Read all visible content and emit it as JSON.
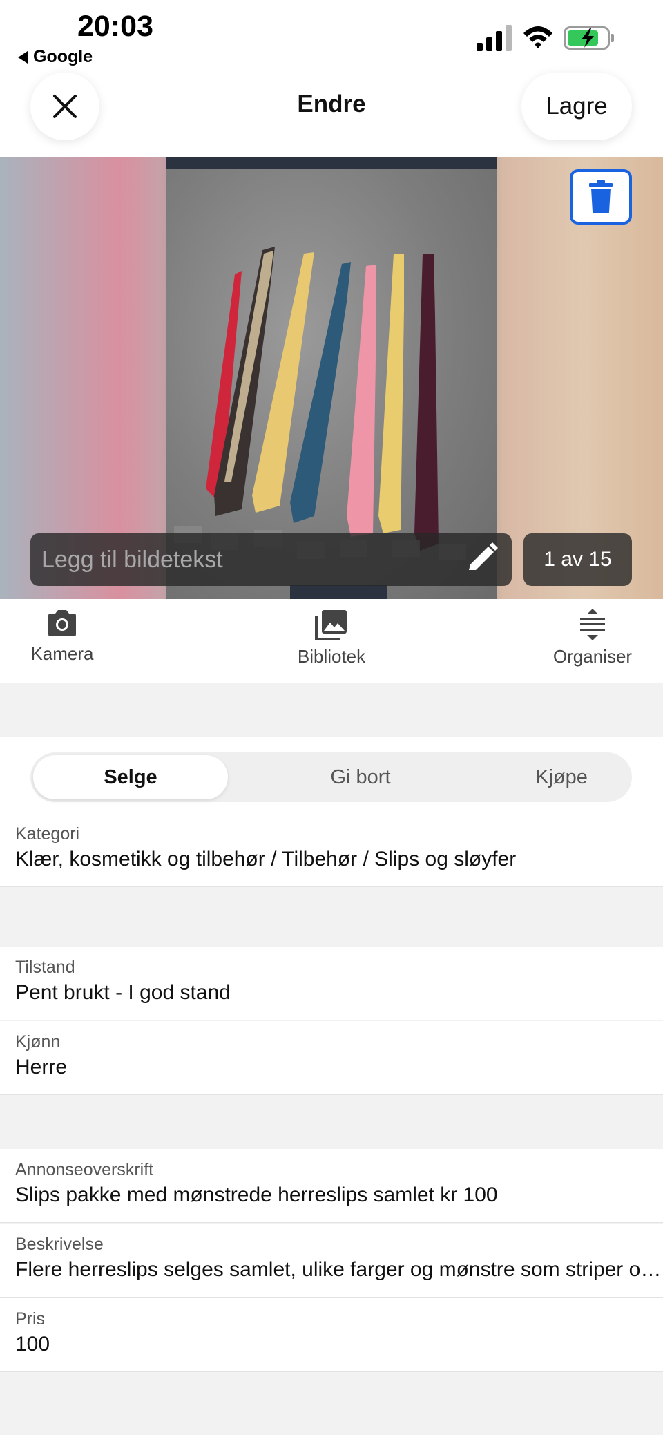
{
  "status_bar": {
    "time": "20:03",
    "back_app": "Google",
    "icons": [
      "signal-icon",
      "wifi-icon",
      "battery-charging-icon"
    ],
    "battery_color": "#34c759"
  },
  "header": {
    "title": "Endre",
    "save_label": "Lagre",
    "close_icon": "close-icon"
  },
  "photo": {
    "caption_placeholder": "Legg til bildetekst",
    "counter": "1 av 15",
    "delete_icon": "trash-icon",
    "accent_color": "#1a63e0"
  },
  "toolbar": {
    "items": [
      {
        "label": "Kamera",
        "icon": "camera-icon"
      },
      {
        "label": "Bibliotek",
        "icon": "image-library-icon"
      },
      {
        "label": "Organiser",
        "icon": "reorder-icon"
      }
    ]
  },
  "segment": {
    "options": [
      "Selge",
      "Gi bort",
      "Kjøpe"
    ],
    "selected": "Selge"
  },
  "fields": {
    "category": {
      "label": "Kategori",
      "value": "Klær, kosmetikk og tilbehør / Tilbehør / Slips og sløyfer"
    },
    "condition": {
      "label": "Tilstand",
      "value": "Pent brukt - I god stand"
    },
    "gender": {
      "label": "Kjønn",
      "value": "Herre"
    },
    "headline": {
      "label": "Annonseoverskrift",
      "value": "Slips pakke med mønstrede herreslips samlet kr 100"
    },
    "description": {
      "label": "Beskrivelse",
      "value": "Flere herreslips selges samlet, ulike farger og mønstre som striper og…"
    },
    "price": {
      "label": "Pris",
      "value": "100"
    }
  }
}
